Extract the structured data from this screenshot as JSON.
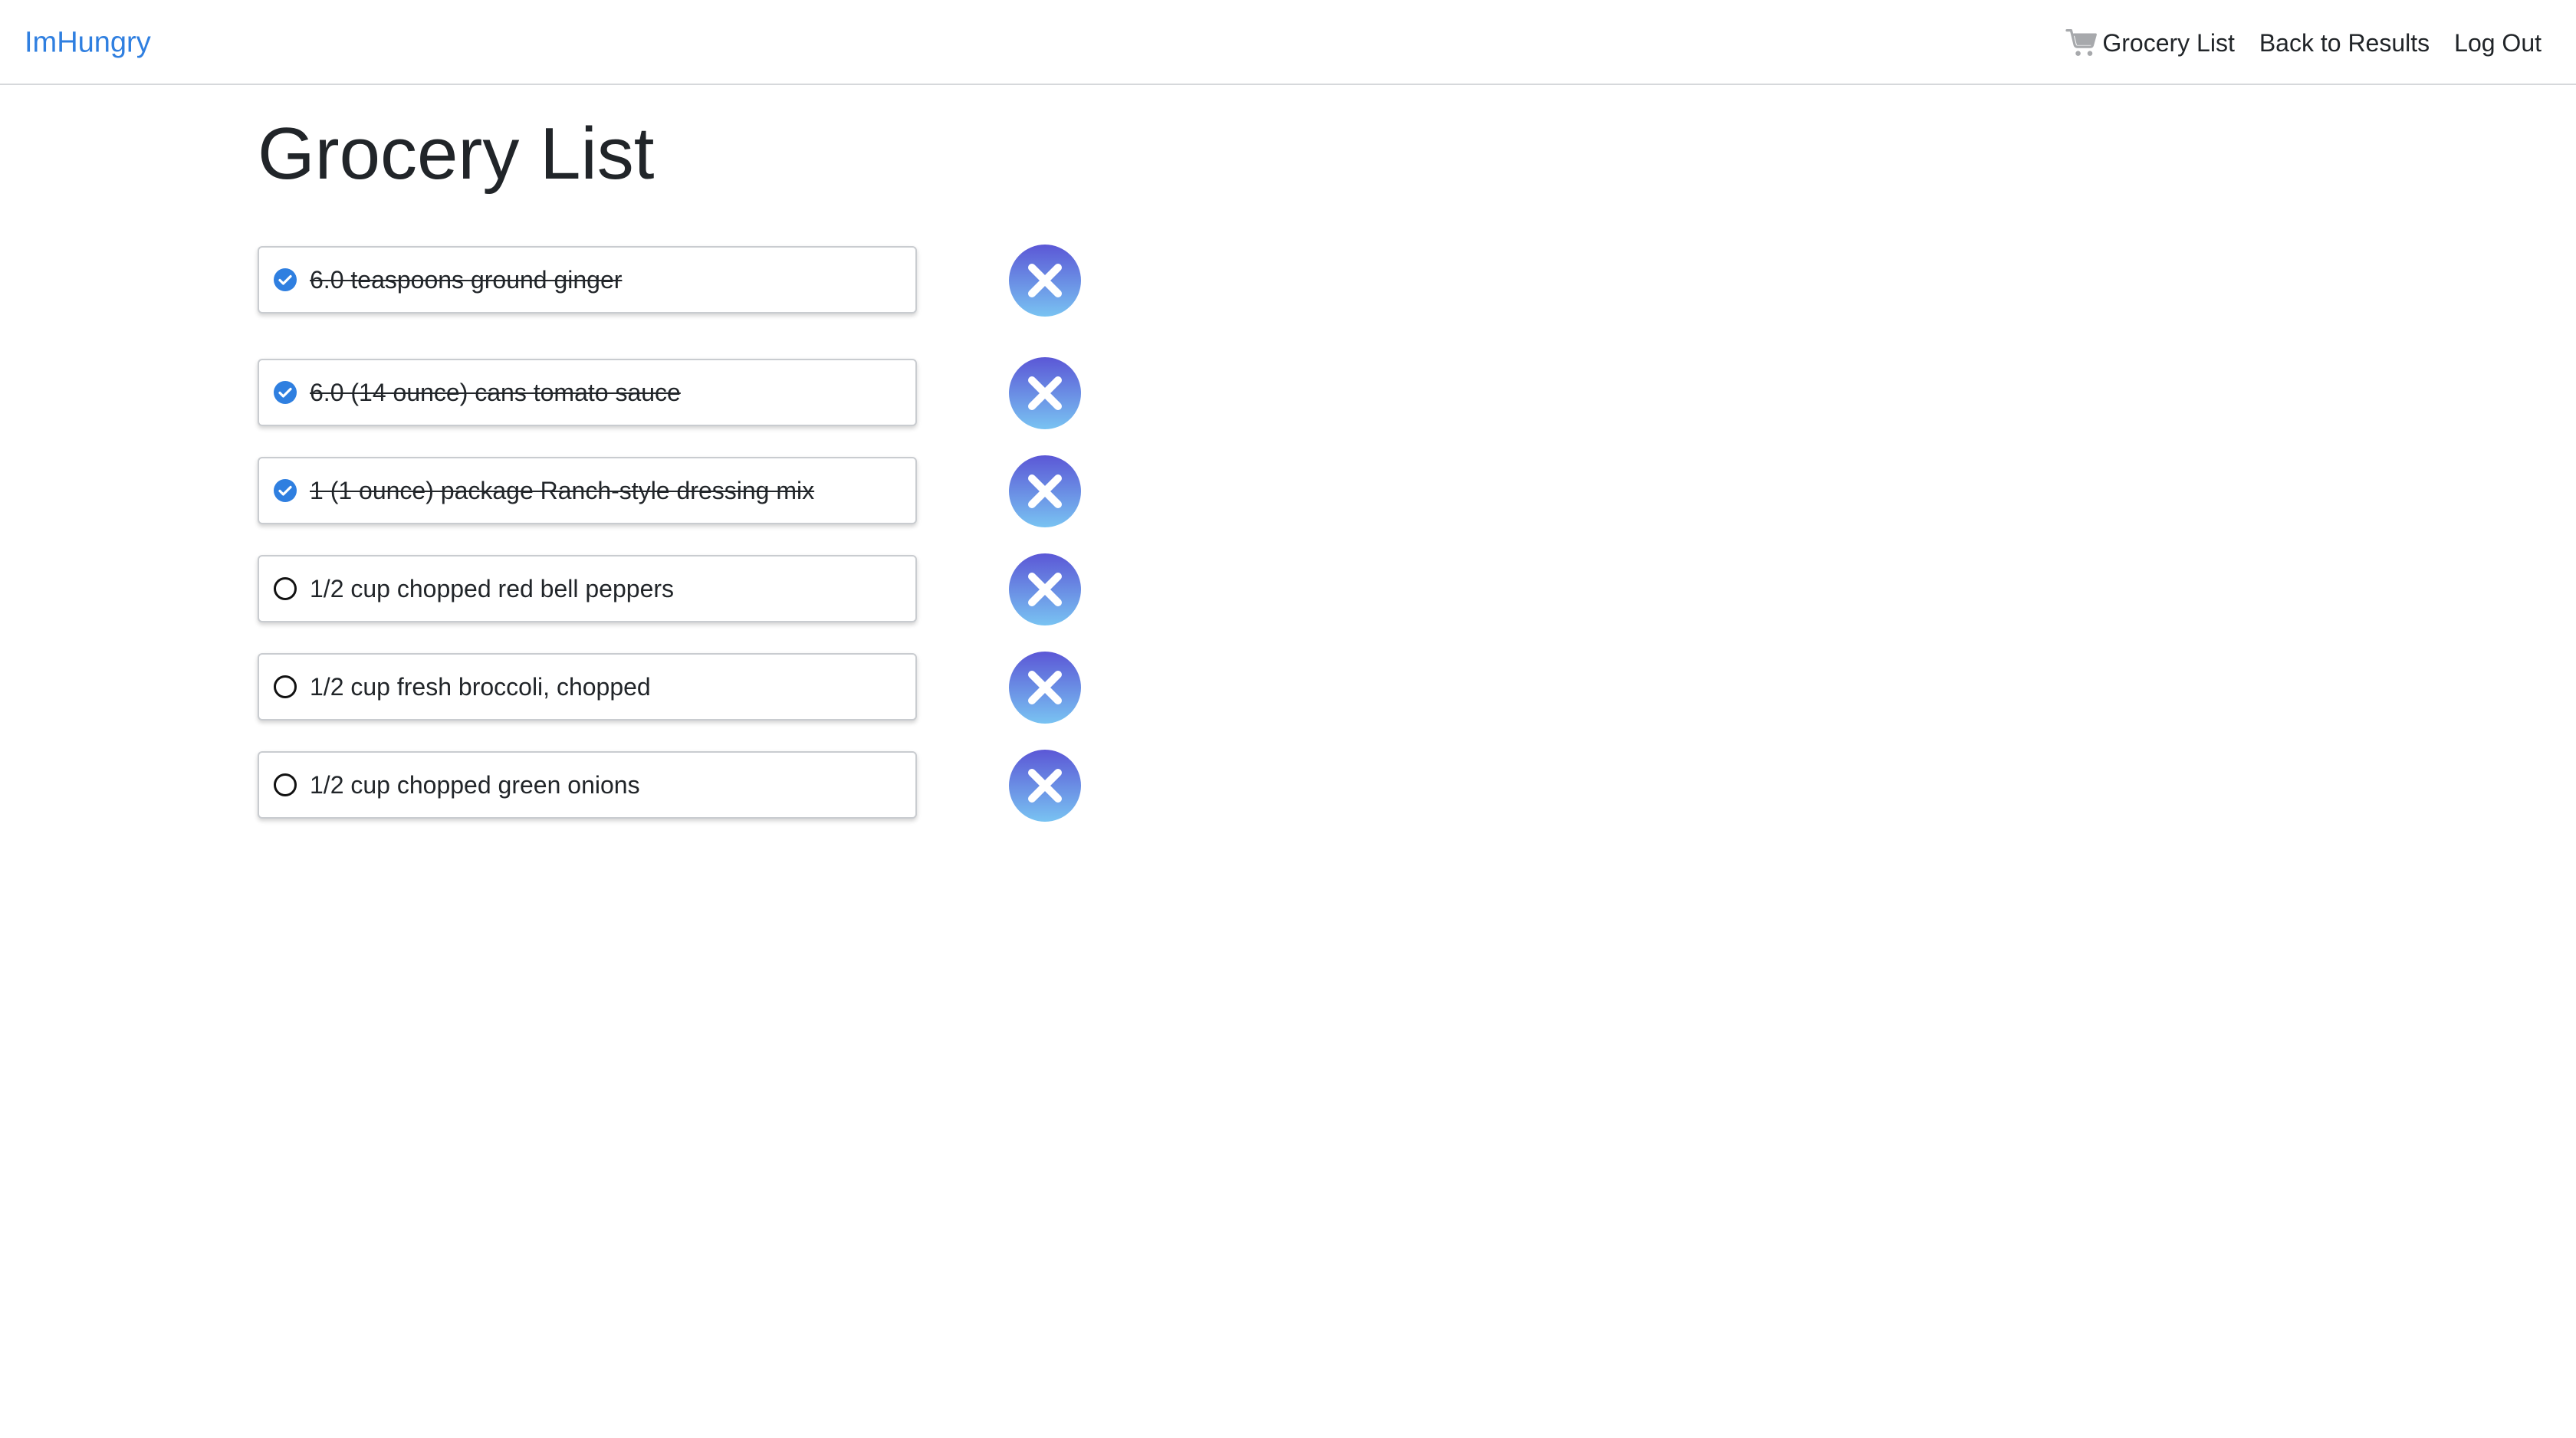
{
  "nav": {
    "brand": "ImHungry",
    "grocery_list": "Grocery List",
    "back_to_results": "Back to Results",
    "log_out": "Log Out",
    "cart_icon": "shopping-cart-icon"
  },
  "page": {
    "title": "Grocery List"
  },
  "items": [
    {
      "text": "6.0 teaspoons ground ginger",
      "checked": true
    },
    {
      "text": "6.0 (14 ounce) cans tomato sauce",
      "checked": true
    },
    {
      "text": "1 (1 ounce) package Ranch-style dressing mix",
      "checked": true
    },
    {
      "text": "1/2 cup chopped red bell peppers",
      "checked": false
    },
    {
      "text": "1/2 cup fresh broccoli, chopped",
      "checked": false
    },
    {
      "text": "1/2 cup chopped green onions",
      "checked": false
    }
  ],
  "colors": {
    "brand": "#2f7fe0",
    "check": "#2f7fe0",
    "remove_top": "#5b57d6",
    "remove_bottom": "#79c3f2"
  }
}
